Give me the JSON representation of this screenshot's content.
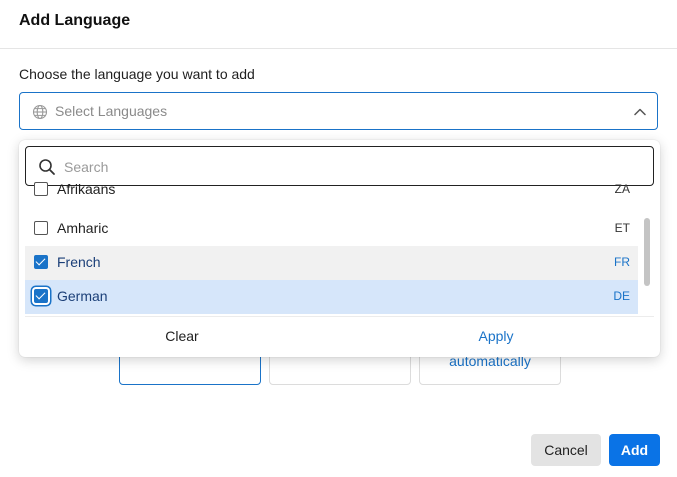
{
  "dialog": {
    "title": "Add Language",
    "field_label": "Choose the language you want to add",
    "select_placeholder": "Select Languages",
    "background_card_text": "automatically"
  },
  "dropdown": {
    "search_placeholder": "Search",
    "options": [
      {
        "name": "Afrikaans",
        "code": "ZA",
        "checked": false
      },
      {
        "name": "Amharic",
        "code": "ET",
        "checked": false
      },
      {
        "name": "French",
        "code": "FR",
        "checked": true
      },
      {
        "name": "German",
        "code": "DE",
        "checked": true
      }
    ],
    "clear_label": "Clear",
    "apply_label": "Apply"
  },
  "footer": {
    "cancel_label": "Cancel",
    "add_label": "Add"
  },
  "colors": {
    "accent": "#1a73c8",
    "primary_button": "#0a73e6"
  },
  "icons": {
    "select": "globe-icon",
    "chevron": "chevron-up-icon",
    "search": "search-icon"
  }
}
